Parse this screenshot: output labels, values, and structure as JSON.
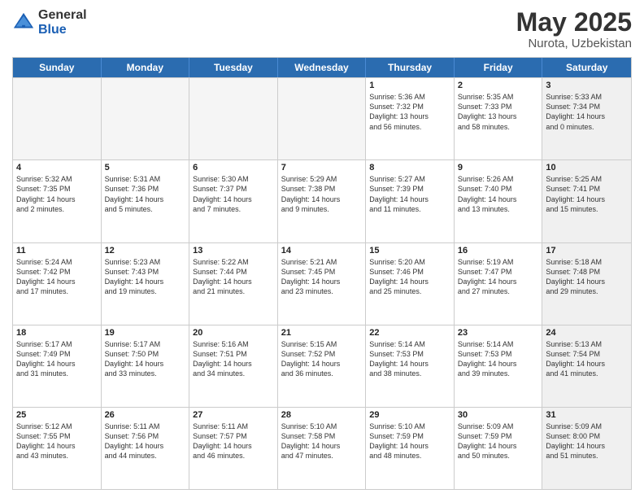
{
  "logo": {
    "general": "General",
    "blue": "Blue"
  },
  "title": {
    "month": "May 2025",
    "location": "Nurota, Uzbekistan"
  },
  "header": {
    "days": [
      "Sunday",
      "Monday",
      "Tuesday",
      "Wednesday",
      "Thursday",
      "Friday",
      "Saturday"
    ]
  },
  "rows": [
    [
      {
        "day": "",
        "empty": true,
        "lines": []
      },
      {
        "day": "",
        "empty": true,
        "lines": []
      },
      {
        "day": "",
        "empty": true,
        "lines": []
      },
      {
        "day": "",
        "empty": true,
        "lines": []
      },
      {
        "day": "1",
        "empty": false,
        "lines": [
          "Sunrise: 5:36 AM",
          "Sunset: 7:32 PM",
          "Daylight: 13 hours",
          "and 56 minutes."
        ]
      },
      {
        "day": "2",
        "empty": false,
        "lines": [
          "Sunrise: 5:35 AM",
          "Sunset: 7:33 PM",
          "Daylight: 13 hours",
          "and 58 minutes."
        ]
      },
      {
        "day": "3",
        "empty": false,
        "shaded": true,
        "lines": [
          "Sunrise: 5:33 AM",
          "Sunset: 7:34 PM",
          "Daylight: 14 hours",
          "and 0 minutes."
        ]
      }
    ],
    [
      {
        "day": "4",
        "empty": false,
        "lines": [
          "Sunrise: 5:32 AM",
          "Sunset: 7:35 PM",
          "Daylight: 14 hours",
          "and 2 minutes."
        ]
      },
      {
        "day": "5",
        "empty": false,
        "lines": [
          "Sunrise: 5:31 AM",
          "Sunset: 7:36 PM",
          "Daylight: 14 hours",
          "and 5 minutes."
        ]
      },
      {
        "day": "6",
        "empty": false,
        "lines": [
          "Sunrise: 5:30 AM",
          "Sunset: 7:37 PM",
          "Daylight: 14 hours",
          "and 7 minutes."
        ]
      },
      {
        "day": "7",
        "empty": false,
        "lines": [
          "Sunrise: 5:29 AM",
          "Sunset: 7:38 PM",
          "Daylight: 14 hours",
          "and 9 minutes."
        ]
      },
      {
        "day": "8",
        "empty": false,
        "lines": [
          "Sunrise: 5:27 AM",
          "Sunset: 7:39 PM",
          "Daylight: 14 hours",
          "and 11 minutes."
        ]
      },
      {
        "day": "9",
        "empty": false,
        "lines": [
          "Sunrise: 5:26 AM",
          "Sunset: 7:40 PM",
          "Daylight: 14 hours",
          "and 13 minutes."
        ]
      },
      {
        "day": "10",
        "empty": false,
        "shaded": true,
        "lines": [
          "Sunrise: 5:25 AM",
          "Sunset: 7:41 PM",
          "Daylight: 14 hours",
          "and 15 minutes."
        ]
      }
    ],
    [
      {
        "day": "11",
        "empty": false,
        "lines": [
          "Sunrise: 5:24 AM",
          "Sunset: 7:42 PM",
          "Daylight: 14 hours",
          "and 17 minutes."
        ]
      },
      {
        "day": "12",
        "empty": false,
        "lines": [
          "Sunrise: 5:23 AM",
          "Sunset: 7:43 PM",
          "Daylight: 14 hours",
          "and 19 minutes."
        ]
      },
      {
        "day": "13",
        "empty": false,
        "lines": [
          "Sunrise: 5:22 AM",
          "Sunset: 7:44 PM",
          "Daylight: 14 hours",
          "and 21 minutes."
        ]
      },
      {
        "day": "14",
        "empty": false,
        "lines": [
          "Sunrise: 5:21 AM",
          "Sunset: 7:45 PM",
          "Daylight: 14 hours",
          "and 23 minutes."
        ]
      },
      {
        "day": "15",
        "empty": false,
        "lines": [
          "Sunrise: 5:20 AM",
          "Sunset: 7:46 PM",
          "Daylight: 14 hours",
          "and 25 minutes."
        ]
      },
      {
        "day": "16",
        "empty": false,
        "lines": [
          "Sunrise: 5:19 AM",
          "Sunset: 7:47 PM",
          "Daylight: 14 hours",
          "and 27 minutes."
        ]
      },
      {
        "day": "17",
        "empty": false,
        "shaded": true,
        "lines": [
          "Sunrise: 5:18 AM",
          "Sunset: 7:48 PM",
          "Daylight: 14 hours",
          "and 29 minutes."
        ]
      }
    ],
    [
      {
        "day": "18",
        "empty": false,
        "lines": [
          "Sunrise: 5:17 AM",
          "Sunset: 7:49 PM",
          "Daylight: 14 hours",
          "and 31 minutes."
        ]
      },
      {
        "day": "19",
        "empty": false,
        "lines": [
          "Sunrise: 5:17 AM",
          "Sunset: 7:50 PM",
          "Daylight: 14 hours",
          "and 33 minutes."
        ]
      },
      {
        "day": "20",
        "empty": false,
        "lines": [
          "Sunrise: 5:16 AM",
          "Sunset: 7:51 PM",
          "Daylight: 14 hours",
          "and 34 minutes."
        ]
      },
      {
        "day": "21",
        "empty": false,
        "lines": [
          "Sunrise: 5:15 AM",
          "Sunset: 7:52 PM",
          "Daylight: 14 hours",
          "and 36 minutes."
        ]
      },
      {
        "day": "22",
        "empty": false,
        "lines": [
          "Sunrise: 5:14 AM",
          "Sunset: 7:53 PM",
          "Daylight: 14 hours",
          "and 38 minutes."
        ]
      },
      {
        "day": "23",
        "empty": false,
        "lines": [
          "Sunrise: 5:14 AM",
          "Sunset: 7:53 PM",
          "Daylight: 14 hours",
          "and 39 minutes."
        ]
      },
      {
        "day": "24",
        "empty": false,
        "shaded": true,
        "lines": [
          "Sunrise: 5:13 AM",
          "Sunset: 7:54 PM",
          "Daylight: 14 hours",
          "and 41 minutes."
        ]
      }
    ],
    [
      {
        "day": "25",
        "empty": false,
        "lines": [
          "Sunrise: 5:12 AM",
          "Sunset: 7:55 PM",
          "Daylight: 14 hours",
          "and 43 minutes."
        ]
      },
      {
        "day": "26",
        "empty": false,
        "lines": [
          "Sunrise: 5:11 AM",
          "Sunset: 7:56 PM",
          "Daylight: 14 hours",
          "and 44 minutes."
        ]
      },
      {
        "day": "27",
        "empty": false,
        "lines": [
          "Sunrise: 5:11 AM",
          "Sunset: 7:57 PM",
          "Daylight: 14 hours",
          "and 46 minutes."
        ]
      },
      {
        "day": "28",
        "empty": false,
        "lines": [
          "Sunrise: 5:10 AM",
          "Sunset: 7:58 PM",
          "Daylight: 14 hours",
          "and 47 minutes."
        ]
      },
      {
        "day": "29",
        "empty": false,
        "lines": [
          "Sunrise: 5:10 AM",
          "Sunset: 7:59 PM",
          "Daylight: 14 hours",
          "and 48 minutes."
        ]
      },
      {
        "day": "30",
        "empty": false,
        "lines": [
          "Sunrise: 5:09 AM",
          "Sunset: 7:59 PM",
          "Daylight: 14 hours",
          "and 50 minutes."
        ]
      },
      {
        "day": "31",
        "empty": false,
        "shaded": true,
        "lines": [
          "Sunrise: 5:09 AM",
          "Sunset: 8:00 PM",
          "Daylight: 14 hours",
          "and 51 minutes."
        ]
      }
    ]
  ]
}
